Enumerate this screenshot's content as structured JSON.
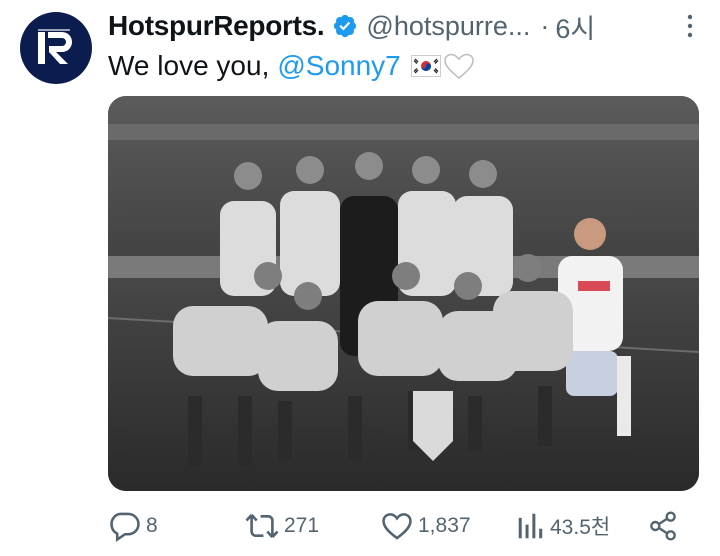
{
  "tweet": {
    "author_name": "HotspurReports.",
    "handle": "@hotspurre...",
    "separator": "·",
    "time": "6시",
    "text": "We love you,",
    "mention": "@Sonny7",
    "flag_icon": "south-korea-flag-icon",
    "heart_icon": "white-heart-icon",
    "photo_description_icon": "team-photo"
  },
  "actions": {
    "replies": "8",
    "retweets": "271",
    "likes": "1,837",
    "views": "43.5천"
  },
  "colors": {
    "link": "#1d9bf0",
    "muted": "#536471",
    "verified": "#1d9bf0",
    "avatar_bg": "#0b1d4e"
  }
}
